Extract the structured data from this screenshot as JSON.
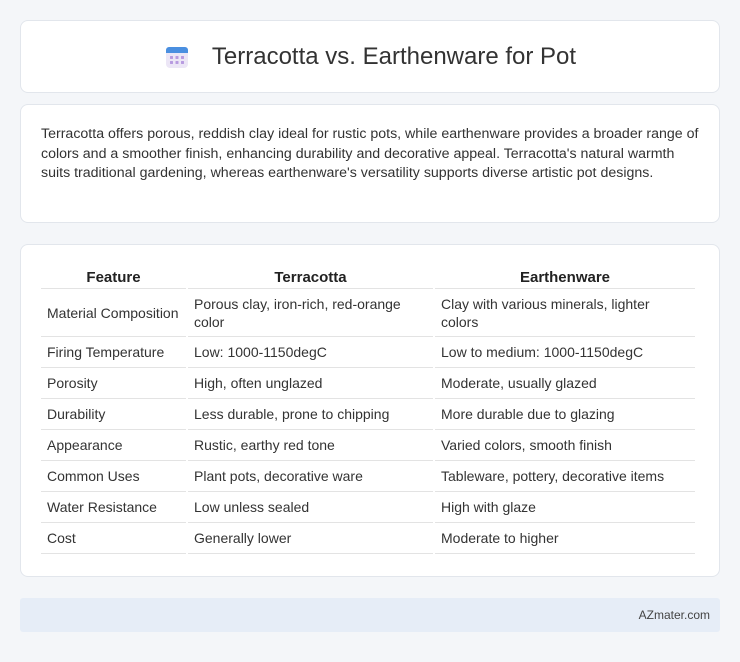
{
  "header": {
    "title": "Terracotta vs. Earthenware for Pot",
    "icon": "calendar-icon"
  },
  "summary": {
    "text": "Terracotta offers porous, reddish clay ideal for rustic pots, while earthenware provides a broader range of colors and a smoother finish, enhancing durability and decorative appeal. Terracotta's natural warmth suits traditional gardening, whereas earthenware's versatility supports diverse artistic pot designs."
  },
  "table": {
    "headers": [
      "Feature",
      "Terracotta",
      "Earthenware"
    ],
    "rows": [
      [
        "Material Composition",
        "Porous clay, iron-rich, red-orange color",
        "Clay with various minerals, lighter colors"
      ],
      [
        "Firing Temperature",
        "Low: 1000-1150degC",
        "Low to medium: 1000-1150degC"
      ],
      [
        "Porosity",
        "High, often unglazed",
        "Moderate, usually glazed"
      ],
      [
        "Durability",
        "Less durable, prone to chipping",
        "More durable due to glazing"
      ],
      [
        "Appearance",
        "Rustic, earthy red tone",
        "Varied colors, smooth finish"
      ],
      [
        "Common Uses",
        "Plant pots, decorative ware",
        "Tableware, pottery, decorative items"
      ],
      [
        "Water Resistance",
        "Low unless sealed",
        "High with glaze"
      ],
      [
        "Cost",
        "Generally lower",
        "Moderate to higher"
      ]
    ]
  },
  "footer": {
    "brand": "AZmater.com"
  }
}
